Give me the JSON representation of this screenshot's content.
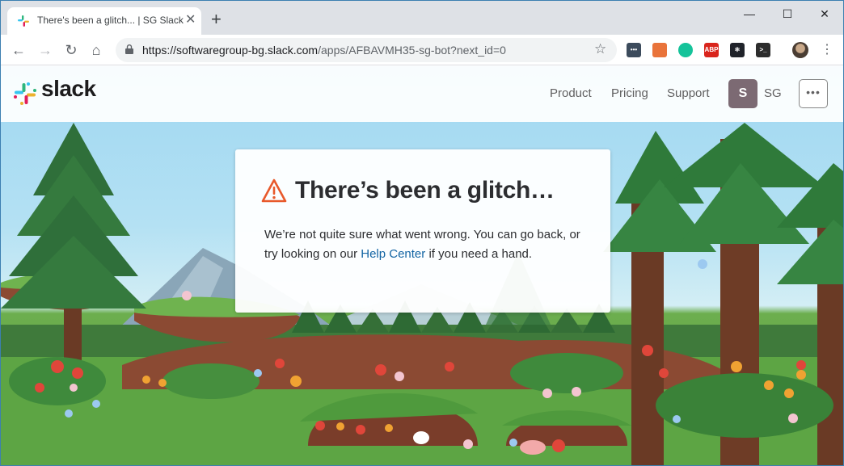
{
  "browser": {
    "tab": {
      "title": "There's been a glitch... | SG Slack",
      "close": "✕"
    },
    "new_tab": "+",
    "controls": {
      "minimize": "—",
      "maximize": "☐",
      "close": "✕"
    },
    "nav": {
      "back": "←",
      "forward": "→",
      "reload": "↻",
      "home": "⌂"
    },
    "url": {
      "host": "https://softwaregroup-bg.slack.com",
      "path": "/apps/AFBAVMH35-sg-bot?next_id=0"
    },
    "bookmark": "☆",
    "menu": "⋮",
    "extensions": [
      {
        "name": "extension-icon",
        "label": "•••",
        "color": "#3c4b5c"
      },
      {
        "name": "cast-icon",
        "label": "",
        "color": "#e9733a"
      },
      {
        "name": "grammarly-icon",
        "label": "",
        "color": "#15c39a"
      },
      {
        "name": "adblock-plus-icon",
        "label": "ABP",
        "color": "#d9251c"
      },
      {
        "name": "react-devtools-icon",
        "label": "⚛",
        "color": "#20232a"
      },
      {
        "name": "terminal-icon",
        "label": ">_",
        "color": "#2d2d2d"
      }
    ]
  },
  "site": {
    "logo_text": "slack",
    "nav": [
      "Product",
      "Pricing",
      "Support"
    ],
    "workspace": {
      "initial": "S",
      "name": "SG"
    },
    "more": "•••"
  },
  "error": {
    "title": "There’s been a glitch…",
    "body_before": "We’re not quite sure what went wrong. You can go back, or try looking on our ",
    "link": "Help Center",
    "body_after": " if you need a hand."
  },
  "colors": {
    "accent_link": "#1264a3",
    "warning": "#e8592b",
    "workspace_avatar": "#7c6a73"
  }
}
